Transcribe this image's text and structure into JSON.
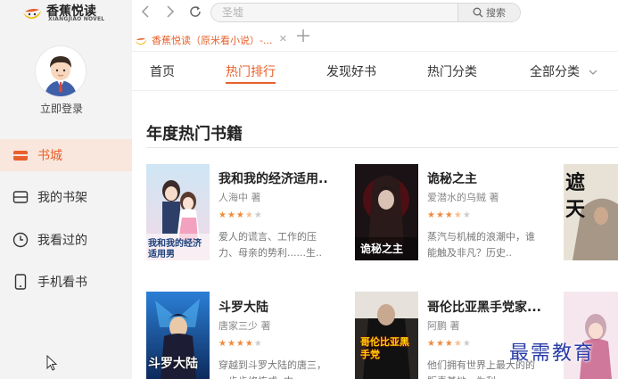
{
  "app": {
    "logo_text": "香蕉悦读",
    "logo_sub": "XIANGJIAO NOVEL",
    "login_label": "立即登录"
  },
  "sidebar": {
    "items": [
      {
        "label": "书城",
        "icon": "store-icon",
        "active": true
      },
      {
        "label": "我的书架",
        "icon": "bookshelf-icon",
        "active": false
      },
      {
        "label": "我看过的",
        "icon": "history-clock-icon",
        "active": false
      },
      {
        "label": "手机看书",
        "icon": "mobile-phone-icon",
        "active": false
      }
    ]
  },
  "toolbar": {
    "search_placeholder": "圣墟",
    "search_button": "搜索"
  },
  "tabs": [
    {
      "title": "香蕉悦读（原米看小说）-..."
    }
  ],
  "content_nav": {
    "items": [
      "首页",
      "热门排行",
      "发现好书",
      "热门分类",
      "全部分类"
    ],
    "active_index": 1
  },
  "section": {
    "title": "年度热门书籍"
  },
  "books": [
    {
      "title": "我和我的经济适用..",
      "author": "人海中 著",
      "rating": 3.5,
      "desc": "爱人的谎言、工作的压力、母亲的势利......生..",
      "cover_text": "我和我的经济适用男"
    },
    {
      "title": "诡秘之主",
      "author": "爱潜水的乌贼 著",
      "rating": 3.5,
      "desc": "蒸汽与机械的浪潮中，谁能触及非凡？历史..",
      "cover_text": "诡秘之主"
    },
    {
      "title": "",
      "author": "",
      "rating": 0,
      "desc": "",
      "cover_text": "遮天"
    },
    {
      "title": "斗罗大陆",
      "author": "唐家三少 著",
      "rating": 4,
      "desc": "穿越到斗罗大陆的唐三，一步步修炼成..中..",
      "cover_text": "斗罗大陆"
    },
    {
      "title": "哥伦比亚黑手党家...",
      "author": "阿鹏 著",
      "rating": 3.5,
      "desc": "他们拥有世界上最大的的販毒基地，为利..",
      "cover_text": "哥伦比亚黑手党"
    },
    {
      "title": "",
      "author": "",
      "rating": 0,
      "desc": "",
      "cover_text": ""
    }
  ],
  "watermark": "最需教育",
  "colors": {
    "accent": "#e8612c",
    "sidebar_bg": "#f3f3f3",
    "active_bg": "#f9e6dd",
    "star": "#f08a3b"
  }
}
